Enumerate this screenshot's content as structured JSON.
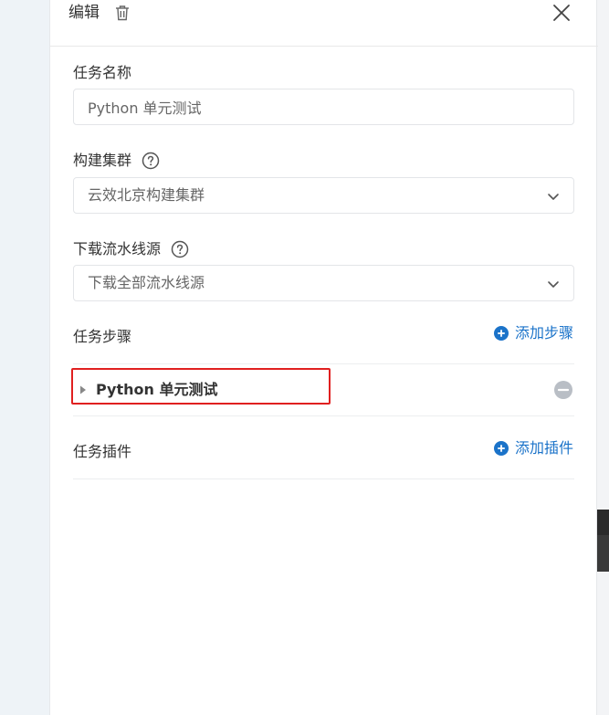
{
  "header": {
    "title": "编辑"
  },
  "form": {
    "task_name": {
      "label": "任务名称",
      "value": "Python 单元测试"
    },
    "build_cluster": {
      "label": "构建集群",
      "selected": "云效北京构建集群"
    },
    "download_source": {
      "label": "下载流水线源",
      "selected": "下载全部流水线源"
    }
  },
  "steps": {
    "title": "任务步骤",
    "add_label": "添加步骤",
    "items": [
      {
        "label": "Python 单元测试"
      }
    ]
  },
  "plugins": {
    "title": "任务插件",
    "add_label": "添加插件"
  },
  "colors": {
    "link": "#1b73c9",
    "highlight": "#e02020",
    "remove": "#b9bec5"
  },
  "icons": {
    "delete": "trash-icon",
    "close": "close-icon",
    "help": "question-circle-icon",
    "dropdown": "chevron-down-icon",
    "add": "plus-circle-icon",
    "expand": "caret-right-icon",
    "remove": "minus-circle-icon"
  }
}
